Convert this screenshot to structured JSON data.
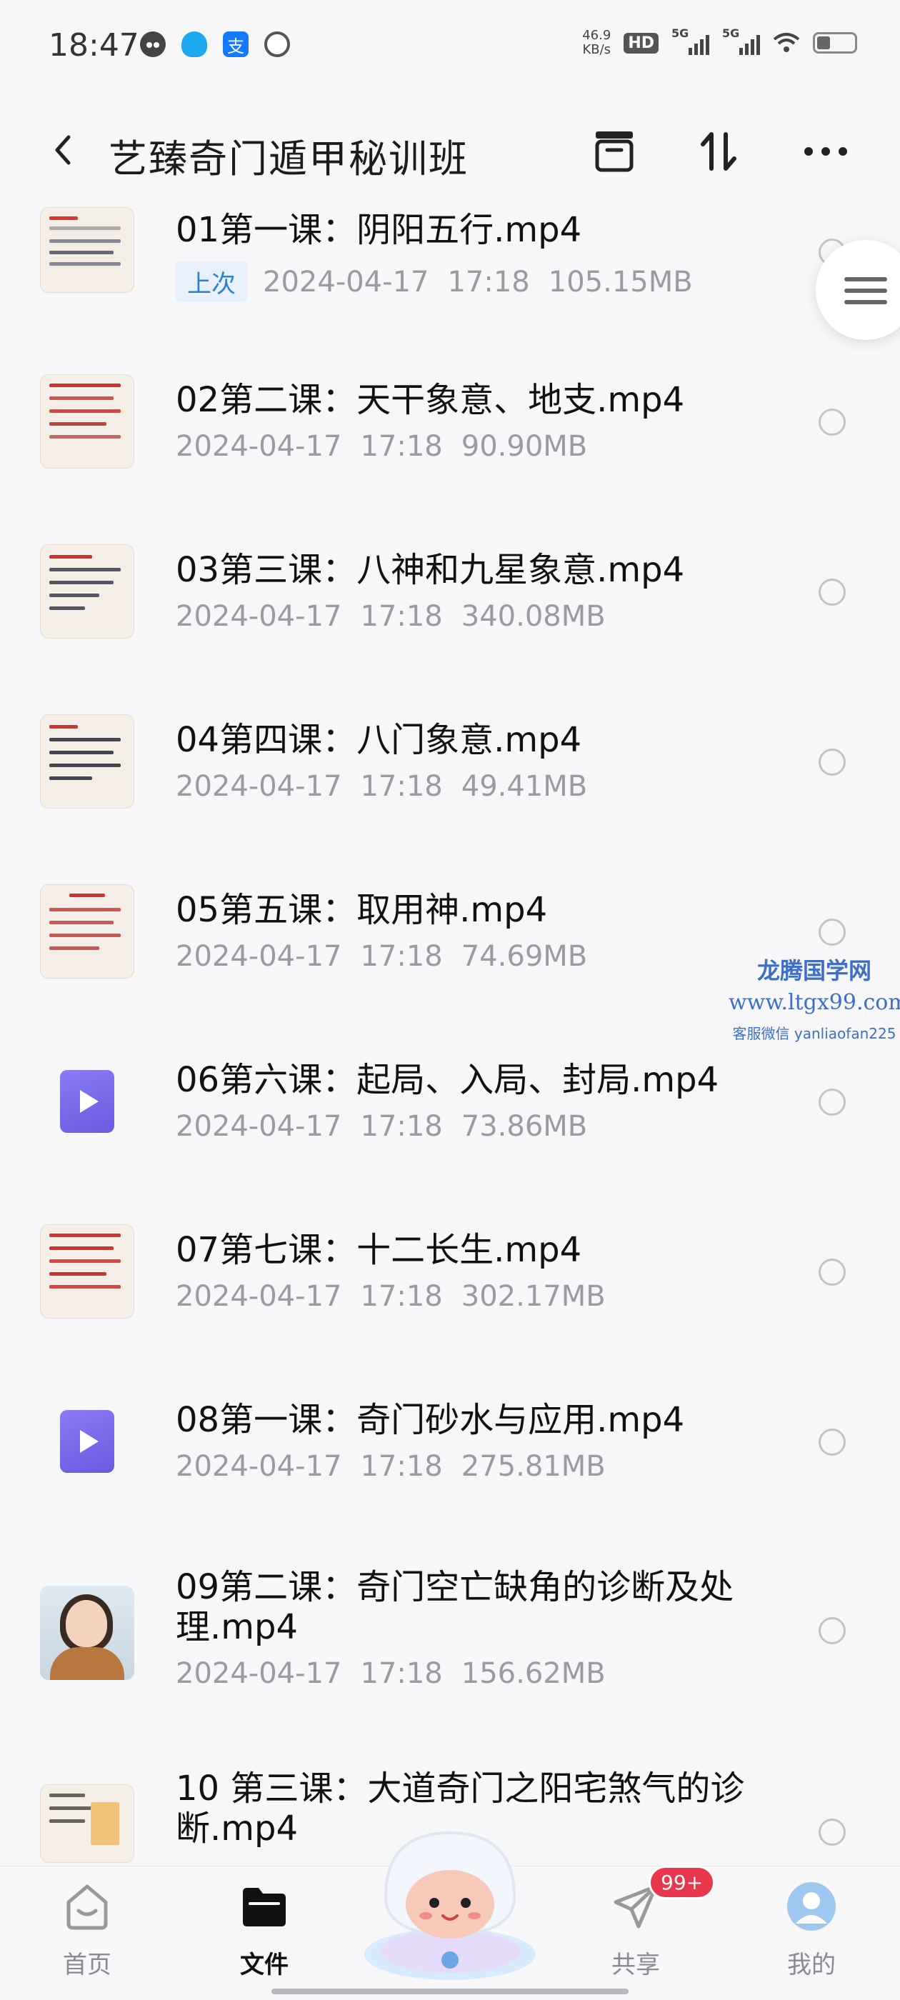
{
  "status_bar": {
    "time": "18:47",
    "net_speed_value": "46.9",
    "net_speed_unit": "KB/s",
    "hd_badge": "HD",
    "signal_1": "5G",
    "signal_2": "5G",
    "icons": [
      "cat-icon",
      "qq-icon",
      "alipay-icon",
      "leaf-icon"
    ]
  },
  "header": {
    "title": "艺臻奇门遁甲秘训班"
  },
  "files": [
    {
      "name": "01第一课：阴阳五行.mp4",
      "date": "2024-04-17",
      "time": "17:18",
      "size": "105.15MB",
      "tag": "上次",
      "thumb": "doc"
    },
    {
      "name": "02第二课：天干象意、地支.mp4",
      "date": "2024-04-17",
      "time": "17:18",
      "size": "90.90MB",
      "thumb": "doc"
    },
    {
      "name": "03第三课：八神和九星象意.mp4",
      "date": "2024-04-17",
      "time": "17:18",
      "size": "340.08MB",
      "thumb": "doc"
    },
    {
      "name": "04第四课：八门象意.mp4",
      "date": "2024-04-17",
      "time": "17:18",
      "size": "49.41MB",
      "thumb": "doc"
    },
    {
      "name": "05第五课：取用神.mp4",
      "date": "2024-04-17",
      "time": "17:18",
      "size": "74.69MB",
      "thumb": "doc"
    },
    {
      "name": "06第六课：起局、入局、封局.mp4",
      "date": "2024-04-17",
      "time": "17:18",
      "size": "73.86MB",
      "thumb": "video"
    },
    {
      "name": "07第七课：十二长生.mp4",
      "date": "2024-04-17",
      "time": "17:18",
      "size": "302.17MB",
      "thumb": "doc"
    },
    {
      "name": "08第一课：奇门砂水与应用.mp4",
      "date": "2024-04-17",
      "time": "17:18",
      "size": "275.81MB",
      "thumb": "video"
    },
    {
      "name_line1": "09第二课：奇门空亡缺角的诊断及处",
      "name_line2": "理.mp4",
      "date": "2024-04-17",
      "time": "17:18",
      "size": "156.62MB",
      "thumb": "person"
    },
    {
      "name_line1": "10  第三课：大道奇门之阳宅煞气的诊",
      "name_line2": "断.mp4",
      "thumb": "doc"
    }
  ],
  "watermark": {
    "line1": "龙腾国学网",
    "line2": "www.ltgx99.com",
    "line3": "客服微信 yanliaofan225"
  },
  "bottom_nav": {
    "home": "首页",
    "files": "文件",
    "share": "共享",
    "mine": "我的",
    "share_badge": "99+"
  },
  "colors": {
    "accent_blue": "#2f80d0",
    "badge_red": "#e8374c",
    "video_purple": "#7a6aec"
  }
}
